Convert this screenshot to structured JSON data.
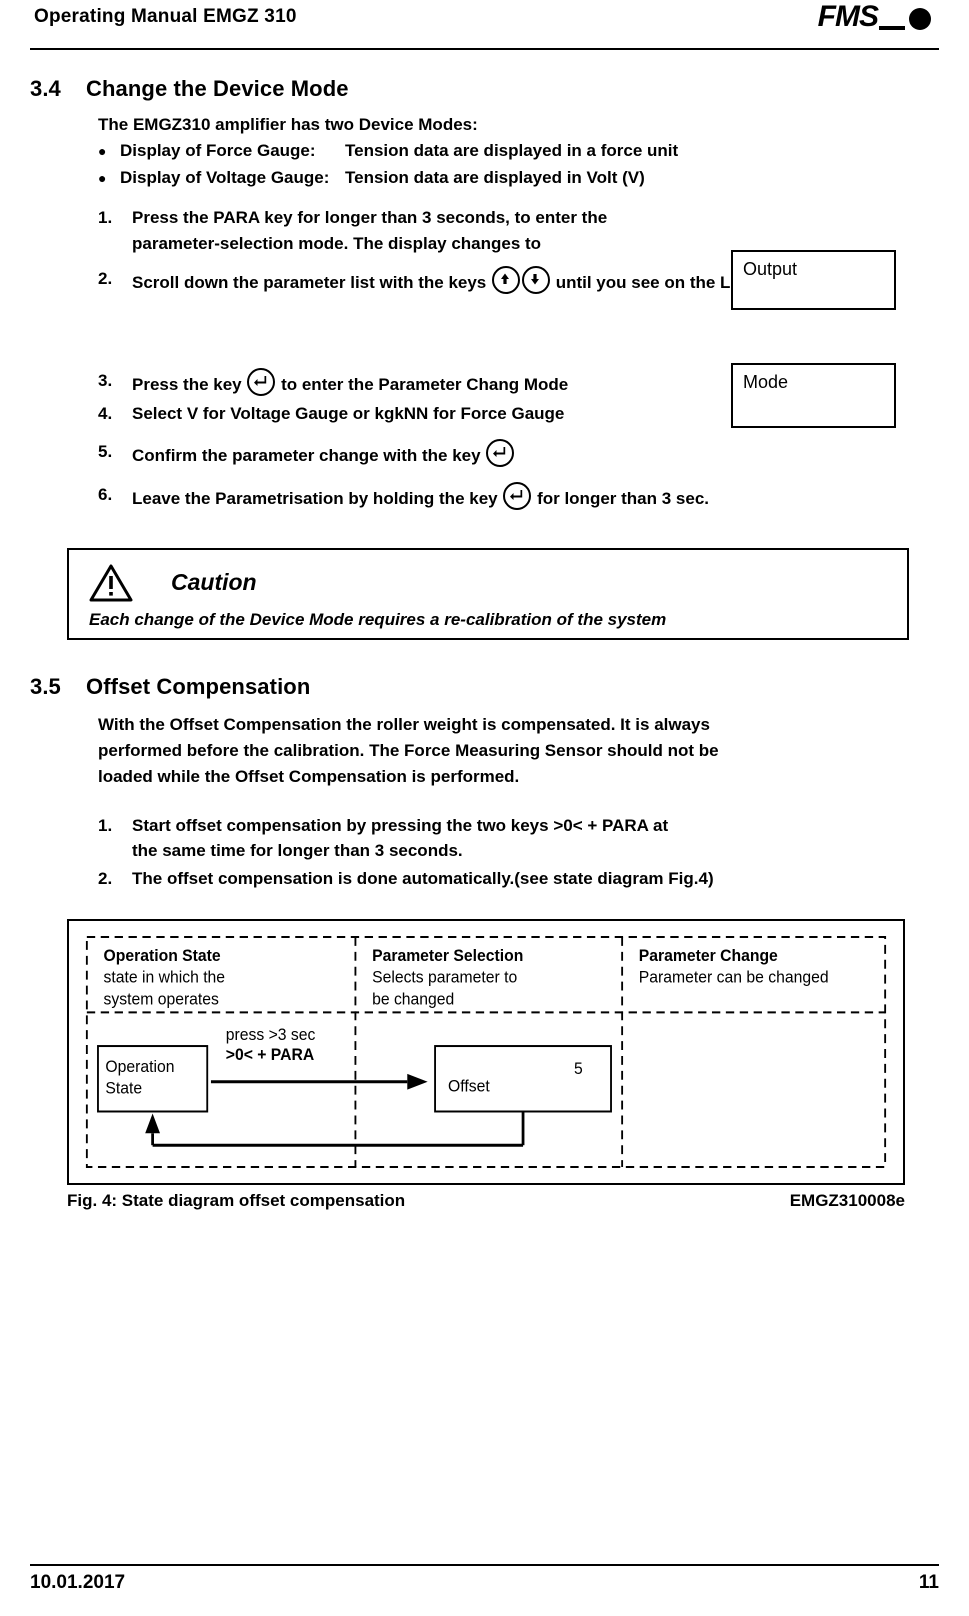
{
  "header": {
    "title": "Operating Manual EMGZ 310",
    "logo_text": "FMS"
  },
  "section_34": {
    "number": "3.4",
    "title": "Change the Device Mode",
    "intro": "The EMGZ310 amplifier has two Device Modes:",
    "bullets": [
      {
        "label": "Display of Force Gauge",
        "sep": ":",
        "desc": "Tension data are displayed in a force unit"
      },
      {
        "label": "Display of Voltage Gauge:",
        "sep": "",
        "desc": "Tension data are displayed in Volt (V)"
      }
    ],
    "steps": [
      {
        "marker": "1.",
        "pre": "Press the ",
        "bold1": "PARA",
        "mid": " key for longer than 3 seconds, to enter the",
        "line2": "parameter-selection mode. The display changes to"
      },
      {
        "marker": "2.",
        "pre": "Scroll down the parameter list with the keys ",
        "post": " until you see on the LCD"
      },
      {
        "marker": "3.",
        "pre": " Press the key ",
        "post": " to enter the Parameter Chang Mode"
      },
      {
        "marker": "4.",
        "pre": "Select ",
        "bold1": "V",
        "mid": " for ",
        "bold2": "Voltage Gauge",
        "mid2": " or ",
        "bold3": "kgkNN",
        "mid3": " for ",
        "bold4": "Force Gauge"
      },
      {
        "marker": "5.",
        "pre": "Confirm the parameter change with the key ",
        "post": ""
      },
      {
        "marker": "6.",
        "pre": "Leave the Parametrisation by holding the key ",
        "post": " for longer than 3 sec."
      }
    ],
    "lcd_output": "Output",
    "lcd_mode": "Mode"
  },
  "caution": {
    "word": "Caution",
    "text": "Each change of the Device Mode requires a re-calibration of the system"
  },
  "section_35": {
    "number": "3.5",
    "title": "Offset Compensation",
    "paragraph_line1": "With the Offset Compensation the roller weight is compensated. It is always",
    "paragraph_line2": "performed before the calibration. The Force Measuring Sensor should not be",
    "paragraph_line3": "loaded while the Offset Compensation is performed.",
    "steps": [
      {
        "marker": "1.",
        "pre": "Start offset compensation by pressing the two keys ",
        "bold1": ">0< + PARA",
        "post": " at",
        "line2": "the same time for longer than 3 seconds."
      },
      {
        "marker": "2.",
        "pre": "The offset compensation is done automatically.(see state diagram ",
        "bold1": "Fig.4",
        "post": ")"
      }
    ]
  },
  "figure": {
    "col1_title": "Operation State",
    "col1_line2": "state in which the",
    "col1_line3": "system operates",
    "col2_title": "Parameter Selection",
    "col2_line2": "Selects parameter to",
    "col2_line3": "be changed",
    "col3_title": "Parameter Change",
    "col3_line2": "Parameter can be changed",
    "box1_line1": "Operation",
    "box1_line2": "State",
    "arrow_label1": "press >3 sec",
    "arrow_label2": ">0< + PARA",
    "box2_label": "Offset",
    "box2_value": "5",
    "caption_fig": "Fig. 4:",
    "caption_text": " State diagram offset compensation",
    "caption_right": "EMGZ310008e"
  },
  "footer": {
    "date": "10.01.2017",
    "page": "11"
  }
}
